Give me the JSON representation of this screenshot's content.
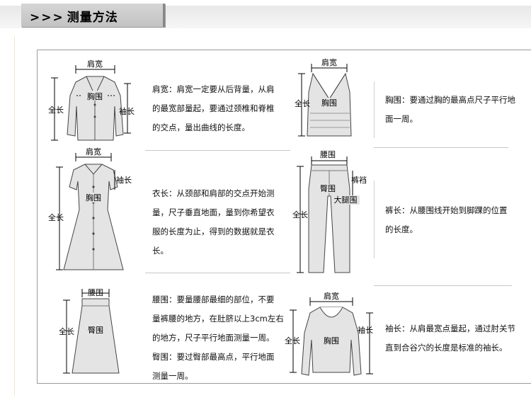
{
  "header": {
    "arrows": ">>>",
    "title": "测量方法"
  },
  "figures": {
    "jacket": {
      "shoulder": "肩宽",
      "chest": "胸围",
      "length": "全长",
      "sleeve": "袖长"
    },
    "vest": {
      "shoulder": "肩宽",
      "chest": "胸围",
      "length": "全长"
    },
    "dress": {
      "shoulder": "肩宽",
      "chest": "胸围",
      "length": "全长",
      "sleeve": "袖长"
    },
    "pants": {
      "waist": "腰围",
      "crotch": "裤裆",
      "hip": "臀围",
      "thigh": "大腿围",
      "length": "全长"
    },
    "skirt": {
      "waist": "腰围",
      "hip": "臀围",
      "length": "全长"
    },
    "sweater": {
      "shoulder": "肩宽",
      "chest": "胸围",
      "length": "全长",
      "sleeve": "袖长"
    }
  },
  "descriptions": {
    "shoulder": [
      "肩宽：肩宽一定要从后背量，从肩",
      "的最宽部量起，要通过颈椎和脊椎",
      "的交点，量出曲线的长度。"
    ],
    "chest": [
      "胸围：要通过胸的最高点尺子平行地",
      "面一周。"
    ],
    "length": [
      "衣长：从颈部和肩部的交点开始测",
      "量，尺子垂直地面，量到你希望衣",
      "服的长度为止，得到的数据就是衣",
      "长。"
    ],
    "pants": [
      "裤长：从腰围线开始到脚踝的位置",
      "的长度。"
    ],
    "waist": [
      "腰围：要量腰部最细的部位，不要",
      "量裤腰的地方，在肚脐以上3cm左右",
      "的地方，尺子平行地面测量一周。"
    ],
    "hip": [
      "臀围：要过臀部最高点，平行地面",
      "测量一周。"
    ],
    "sleeve": [
      "袖长：从肩最宽点量起，通过肘关节",
      "直到合谷穴的长度是标准的袖长。"
    ]
  }
}
